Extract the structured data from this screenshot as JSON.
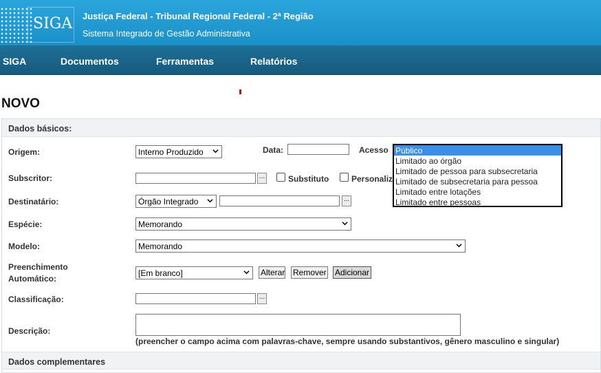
{
  "header": {
    "logo_text": "SIGA",
    "title": "Justiça Federal - Tribunal Regional Federal - 2ª Região",
    "subtitle": "Sistema Integrado de Gestão Administrativa"
  },
  "nav": {
    "items": [
      "SIGA",
      "Documentos",
      "Ferramentas",
      "Relatórios"
    ]
  },
  "page": {
    "title": "NOVO"
  },
  "form": {
    "section_basic": "Dados básicos:",
    "section_complementary": "Dados complementares",
    "origem": {
      "label": "Origem:",
      "value": "Interno Produzido"
    },
    "data": {
      "label": "Data:",
      "value": ""
    },
    "acesso": {
      "label": "Acesso",
      "options": [
        "Público",
        "Limitado ao órgão",
        "Limitado de pessoa para subsecretaria",
        "Limitado de subsecretaria para pessoa",
        "Limitado entre lotações",
        "Limitado entre pessoas"
      ],
      "selected_index": 0
    },
    "subscritor": {
      "label": "Subscritor:",
      "value": "",
      "substituto_label": "Substituto",
      "personalizar_label": "Personaliz"
    },
    "destinatario": {
      "label": "Destinatário:",
      "type_value": "Órgão Integrado",
      "value": ""
    },
    "especie": {
      "label": "Espécie:",
      "value": "Memorando"
    },
    "modelo": {
      "label": "Modelo:",
      "value": "Memorando"
    },
    "preenchimento": {
      "label_line1": "Preenchimento",
      "label_line2": "Automático:",
      "value": "[Em branco]",
      "alterar": "Alterar",
      "remover": "Remover",
      "adicionar": "Adicionar"
    },
    "classificacao": {
      "label": "Classificação:",
      "value": ""
    },
    "descricao": {
      "label": "Descrição:",
      "value": "",
      "hint": "(preencher o campo acima com palavras-chave, sempre usando substantivos, gênero masculino e singular)"
    },
    "dots_label": "..."
  }
}
